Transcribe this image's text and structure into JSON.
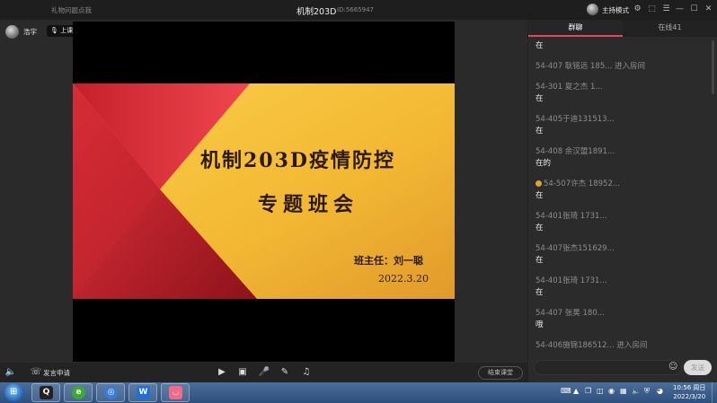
{
  "topbar": {
    "left_text": "礼物问题点我",
    "title": "机制203D",
    "room_id": "ID:5665947",
    "host_mode_label": "主持模式",
    "window_icons": [
      "settings-icon",
      "share-icon",
      "minimize-icon",
      "maximize-icon",
      "close-icon"
    ]
  },
  "video": {
    "user_name": "浩宇",
    "status": "上课中",
    "slide": {
      "title_line1": "机制203D疫情防控",
      "title_line2": "专题班会",
      "teacher": "班主任：刘一聪",
      "date": "2022.3.20",
      "colors": {
        "red": "#e8353f",
        "yellow": "#f7c43a",
        "dark_red": "#a0161e"
      }
    }
  },
  "toolbar": {
    "apply_label": "发言申请",
    "end_label": "结束课堂"
  },
  "panel": {
    "tabs": [
      {
        "label": "群聊"
      },
      {
        "label": "在线41"
      }
    ],
    "messages": [
      {
        "kind": "text",
        "text": "在"
      },
      {
        "kind": "meta",
        "text": "54-407 耿铭远 185... 进入房间"
      },
      {
        "kind": "meta",
        "text": "54-301  夏之杰  1..."
      },
      {
        "kind": "text",
        "text": "在"
      },
      {
        "kind": "meta",
        "text": "54-405于迪131513..."
      },
      {
        "kind": "text",
        "text": "在"
      },
      {
        "kind": "meta",
        "text": "54-408 余汉盟1891..."
      },
      {
        "kind": "text",
        "text": "在的"
      },
      {
        "kind": "meta",
        "text": "54-507许杰 18952...",
        "badge": true
      },
      {
        "kind": "text",
        "text": "在"
      },
      {
        "kind": "meta",
        "text": "54-401张琦  1731..."
      },
      {
        "kind": "text",
        "text": "在"
      },
      {
        "kind": "meta",
        "text": "54-407张杰151629..."
      },
      {
        "kind": "text",
        "text": "在"
      },
      {
        "kind": "meta",
        "text": "54-401张琦  1731..."
      },
      {
        "kind": "text",
        "text": "在"
      },
      {
        "kind": "meta",
        "text": "54-407  张昊  180..."
      },
      {
        "kind": "text",
        "text": "哦"
      },
      {
        "kind": "meta",
        "text": "54-406施锦186512... 进入房间"
      }
    ],
    "send_label": "发送"
  },
  "taskbar": {
    "apps": [
      "qq",
      "360-browser",
      "tool",
      "wps",
      "classin"
    ],
    "clock_time": "10:56 周日",
    "clock_date": "2022/3/20"
  }
}
